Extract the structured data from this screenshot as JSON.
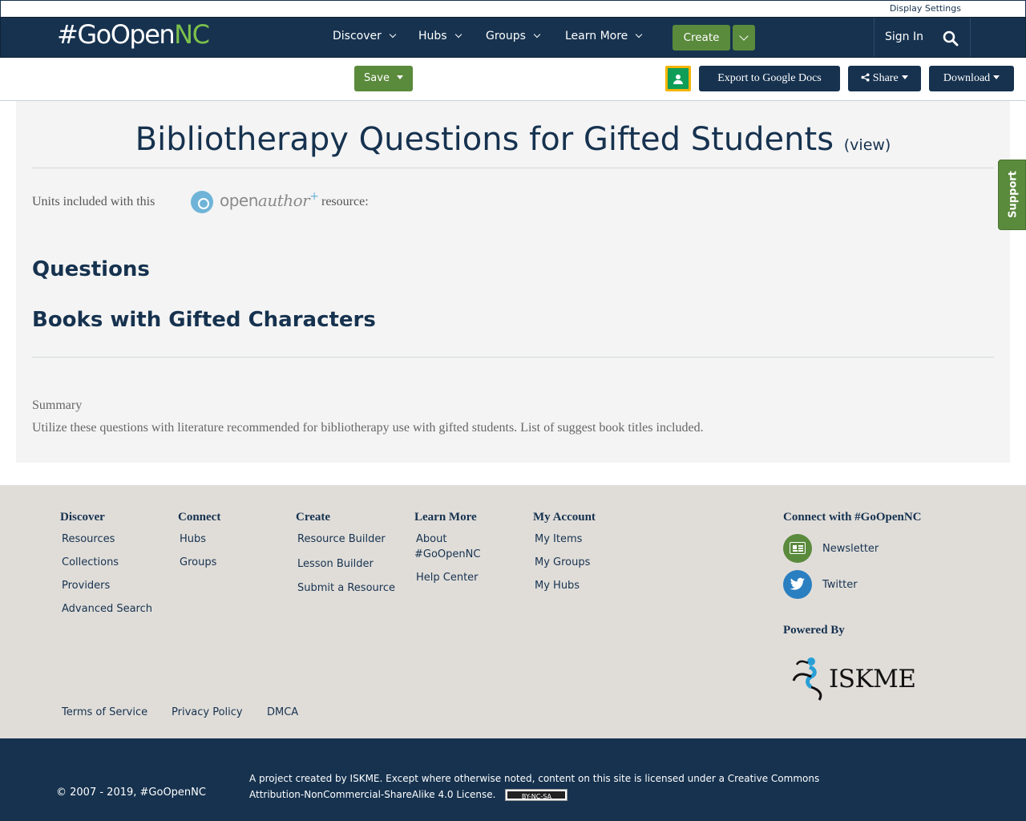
{
  "utility": {
    "display_settings": "Display Settings"
  },
  "nav": {
    "logo_main": "#GoOpen",
    "logo_accent": "NC",
    "items": [
      {
        "label": "Discover"
      },
      {
        "label": "Hubs"
      },
      {
        "label": "Groups"
      },
      {
        "label": "Learn More"
      }
    ],
    "create_label": "Create",
    "sign_in": "Sign In"
  },
  "toolbar": {
    "save_label": "Save",
    "export_label": "Export to Google Docs",
    "share_label": "Share",
    "download_label": "Download"
  },
  "resource": {
    "title": "Bibliotherapy Questions for Gifted Students",
    "view_link": "(view)",
    "units_prefix": "Units included with this",
    "units_suffix": "resource:",
    "open_author_brand": "open",
    "open_author_brand_2": "author",
    "units": [
      {
        "title": "Questions"
      },
      {
        "title": "Books with Gifted Characters"
      }
    ],
    "summary_label": "Summary",
    "summary_text": "Utilize these questions with literature recommended for bibliotherapy use with gifted students. List of suggest book titles included."
  },
  "support_tab": "Support",
  "footer": {
    "columns": [
      {
        "heading": "Discover",
        "links": [
          "Resources",
          "Collections",
          "Providers",
          "Advanced Search"
        ]
      },
      {
        "heading": "Connect",
        "links": [
          "Hubs",
          "Groups"
        ]
      },
      {
        "heading": "Create",
        "links": [
          "Resource Builder",
          "Lesson Builder",
          "Submit a Resource"
        ]
      },
      {
        "heading": "Learn More",
        "links": [
          "About #GoOpenNC",
          "Help Center"
        ]
      },
      {
        "heading": "My Account",
        "links": [
          "My Items",
          "My Groups",
          "My Hubs"
        ]
      }
    ],
    "connect_heading": "Connect with #GoOpenNC",
    "newsletter": "Newsletter",
    "twitter": "Twitter",
    "powered_by": "Powered By",
    "iskme": "ISKME",
    "legal": [
      "Terms of Service",
      "Privacy Policy",
      "DMCA"
    ]
  },
  "bottom": {
    "copyright": "© 2007 - 2019, #GoOpenNC",
    "license_text": "A project created by ISKME. Except where otherwise noted, content on this site is licensed under a Creative Commons Attribution-NonCommercial-ShareAlike 4.0 License.",
    "cc_badge": "BY-NC-SA"
  },
  "colors": {
    "navy": "#16324f",
    "green": "#5a8a3c",
    "panel": "#f4f4f4",
    "footer": "#e0ddd9"
  }
}
